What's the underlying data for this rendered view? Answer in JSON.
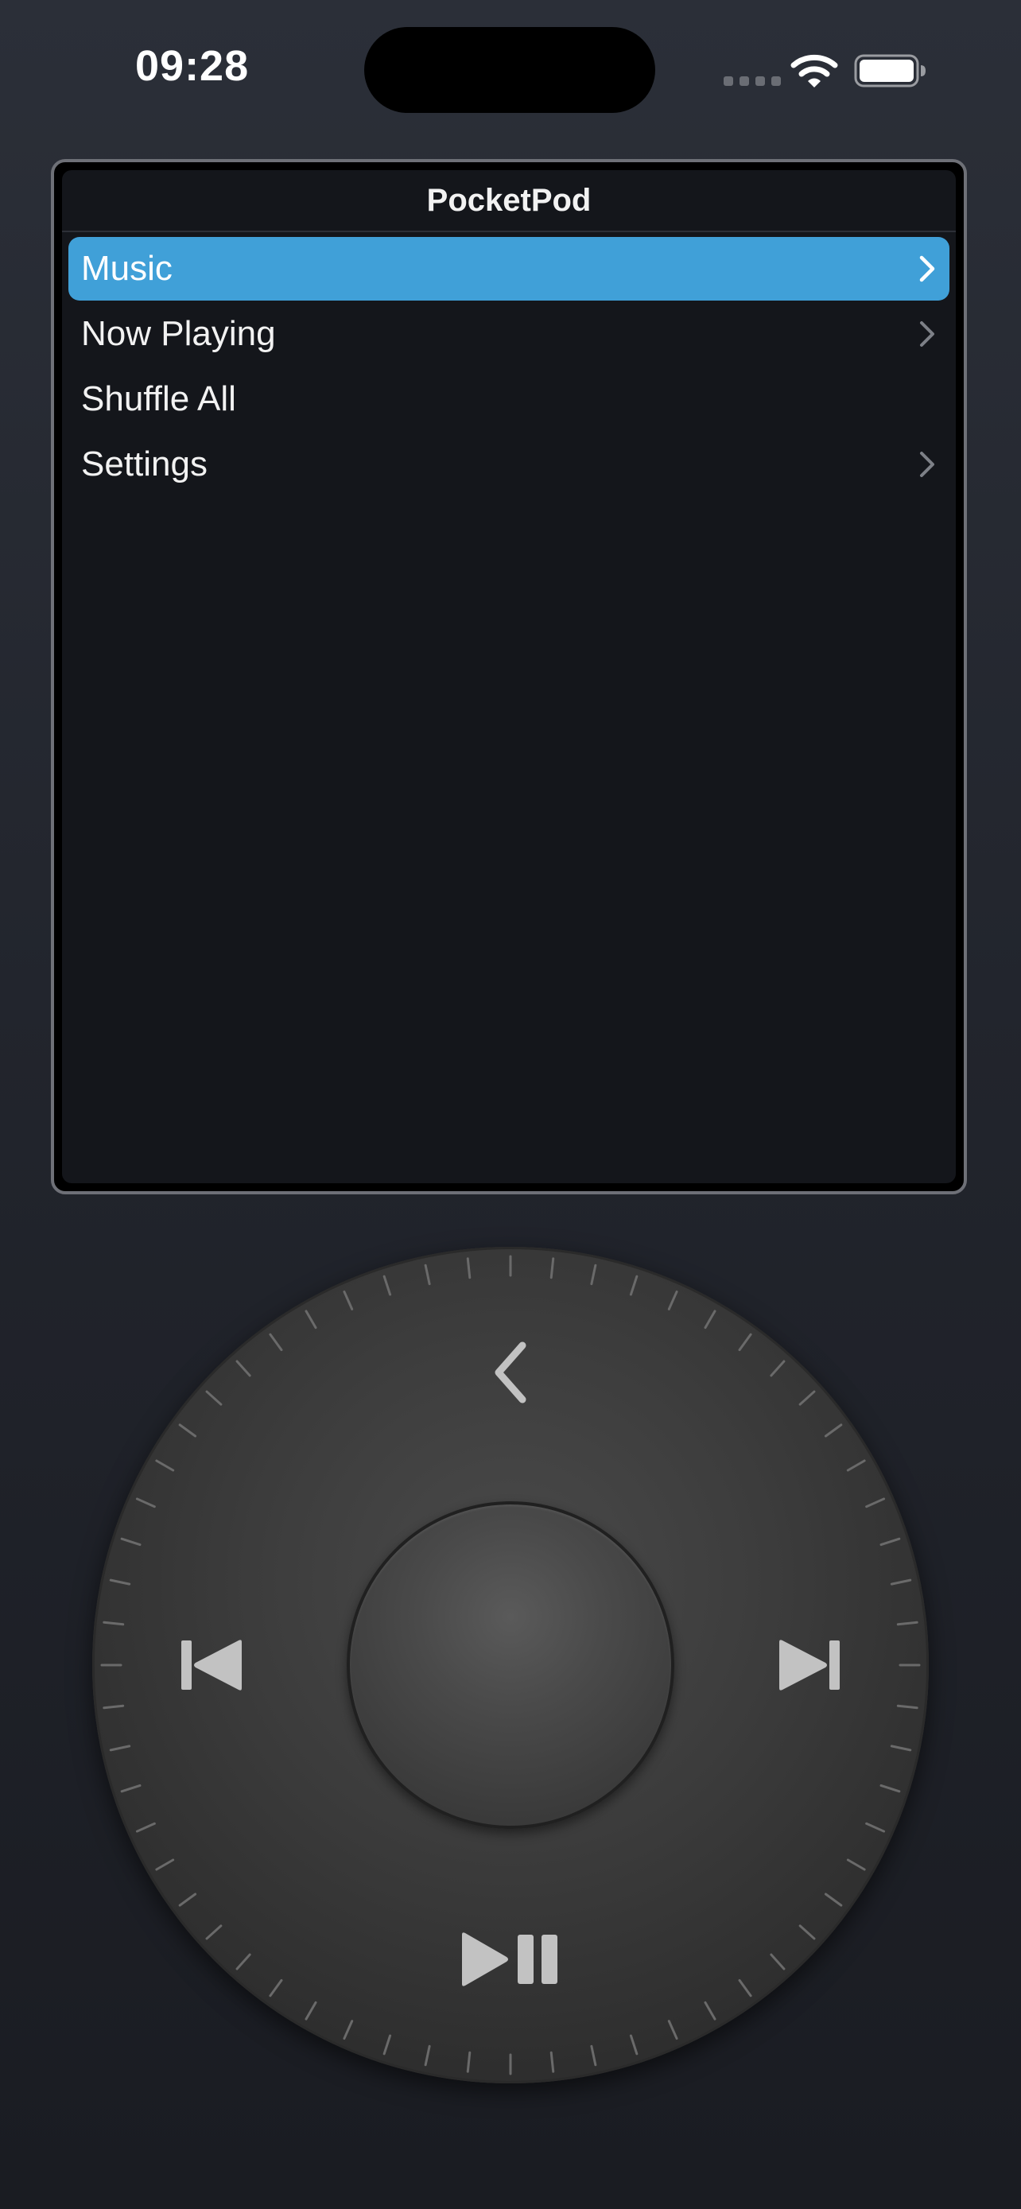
{
  "status_bar": {
    "time": "09:28",
    "icons": [
      "cellular-signal-icon",
      "wifi-icon",
      "battery-icon"
    ]
  },
  "screen": {
    "title": "PocketPod",
    "menu_items": [
      {
        "label": "Music",
        "selected": true,
        "has_chevron": true
      },
      {
        "label": "Now Playing",
        "selected": false,
        "has_chevron": true
      },
      {
        "label": "Shuffle All",
        "selected": false,
        "has_chevron": false
      },
      {
        "label": "Settings",
        "selected": false,
        "has_chevron": true
      }
    ]
  },
  "wheel": {
    "controls": [
      "menu-back-icon",
      "previous-track-icon",
      "next-track-icon",
      "play-pause-icon"
    ]
  },
  "colors": {
    "selection": "#40a0d8",
    "screen_background": "#14161b",
    "page_background": "#262932"
  }
}
